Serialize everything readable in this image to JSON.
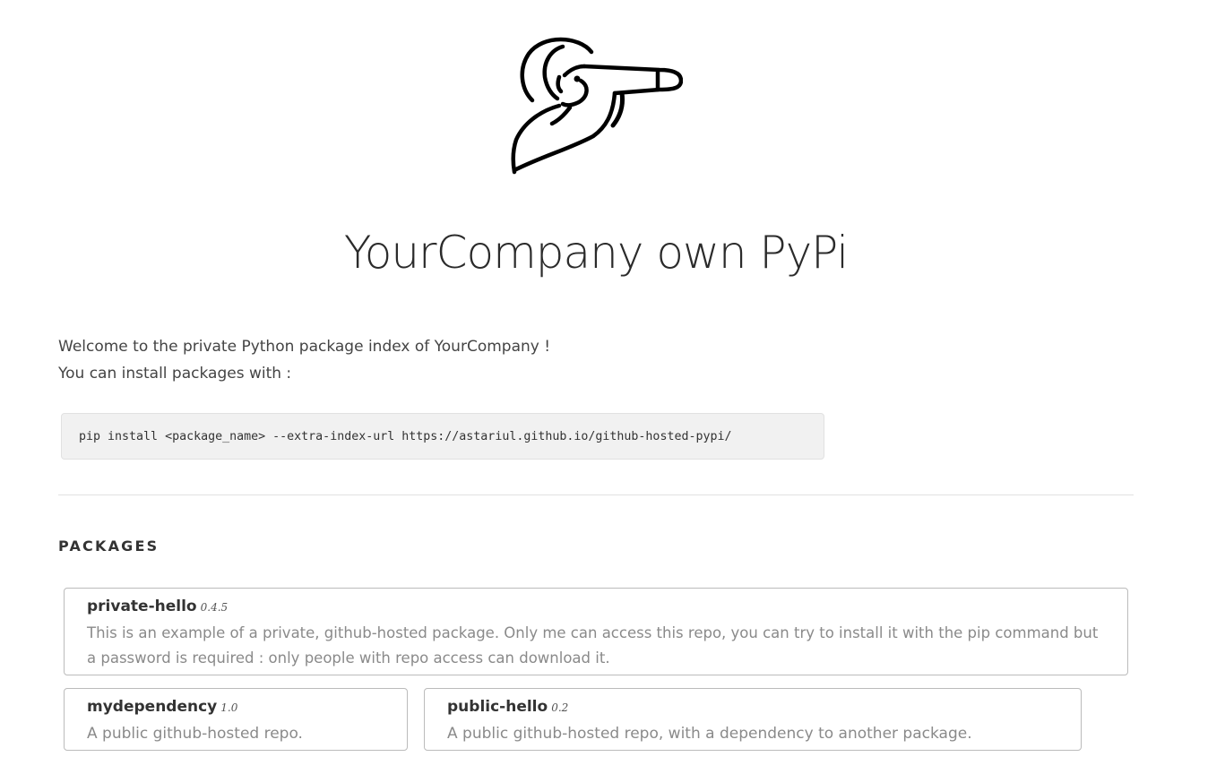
{
  "header": {
    "logo_icon": "spyglass-man-icon",
    "title": "YourCompany own PyPi"
  },
  "intro": {
    "line1": "Welcome to the private Python package index of YourCompany !",
    "line2": "You can install packages with :"
  },
  "install_command": "pip install <package_name> --extra-index-url https://astariul.github.io/github-hosted-pypi/",
  "packages_section": {
    "heading": "PACKAGES",
    "items": [
      {
        "name": "private-hello",
        "version": "0.4.5",
        "description": "This is an example of a private, github-hosted package. Only me can access this repo, you can try to install it with the pip command but a password is required : only people with repo access can download it."
      },
      {
        "name": "mydependency",
        "version": "1.0",
        "description": "A public github-hosted repo."
      },
      {
        "name": "public-hello",
        "version": "0.2",
        "description": "A public github-hosted repo, with a dependency to another package."
      }
    ]
  },
  "colors": {
    "text": "#333333",
    "muted_text": "#8a8a8a",
    "code_background": "#f1f1f1",
    "card_border": "#bbbbbb",
    "divider": "#e1e1e1"
  }
}
